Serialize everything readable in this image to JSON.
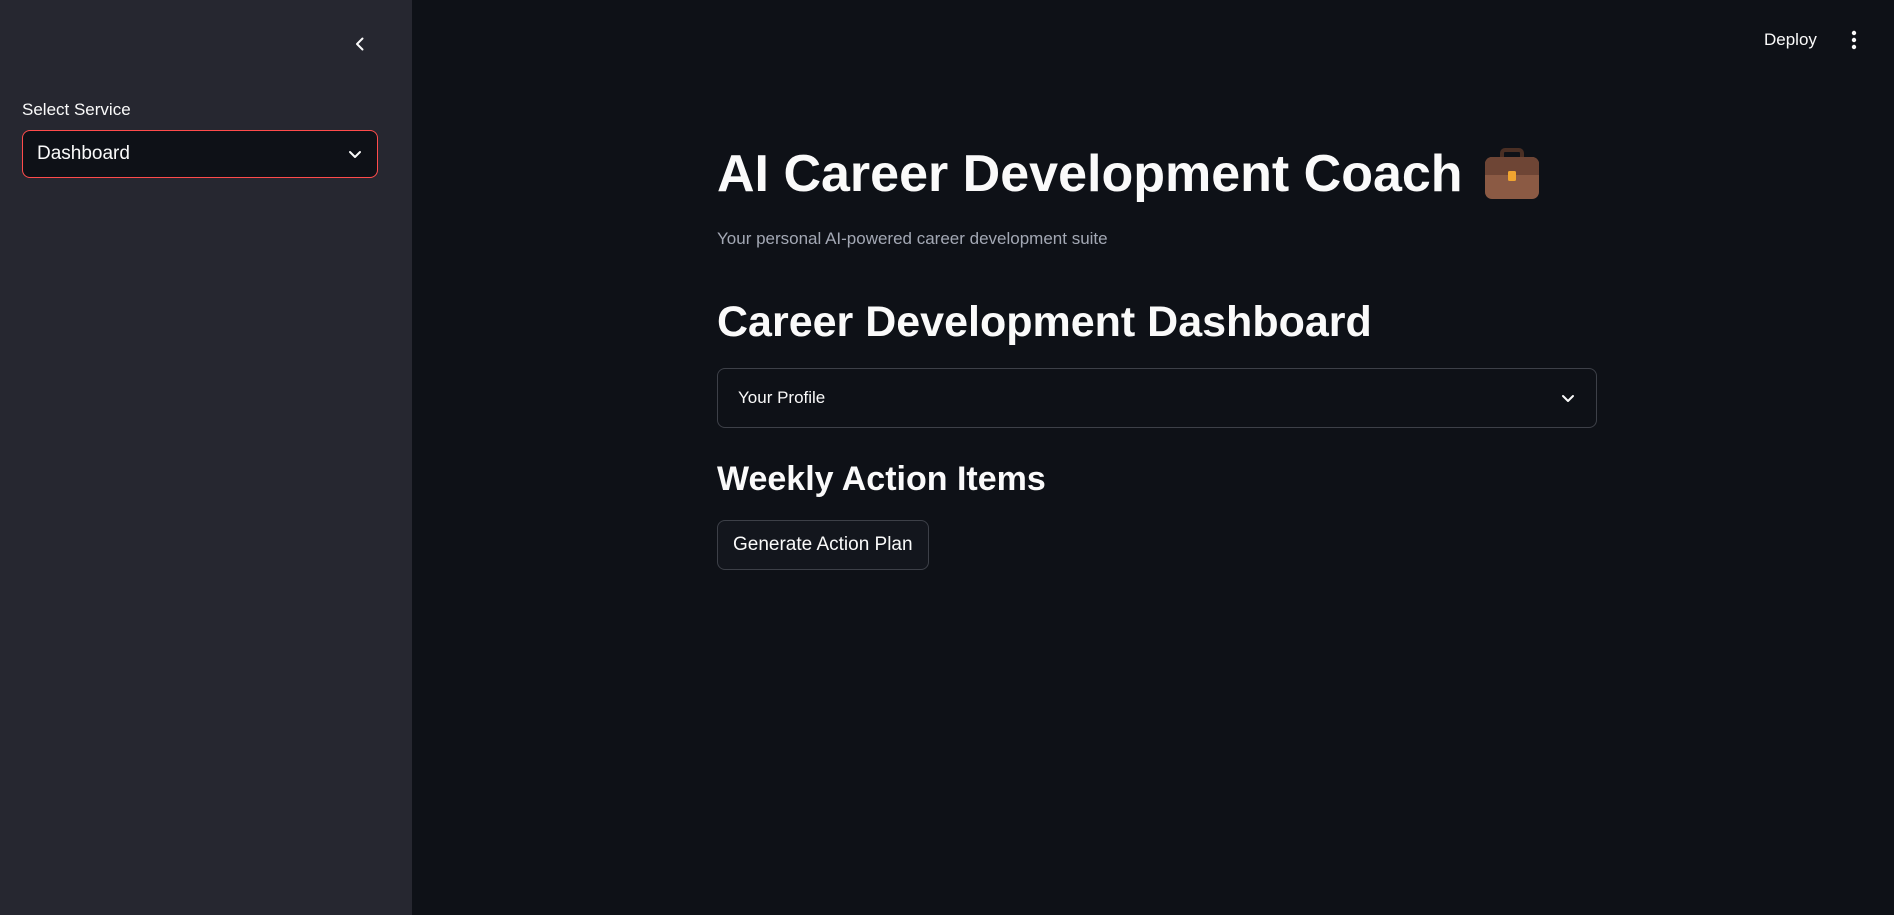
{
  "sidebar": {
    "collapse_icon": "chevron-left-icon",
    "select_label": "Select Service",
    "select_value": "Dashboard",
    "select_icon": "chevron-down-icon",
    "accent_color": "#ff4b4b"
  },
  "header": {
    "deploy_label": "Deploy",
    "menu_icon": "vertical-dots-icon"
  },
  "main": {
    "title": "AI Career Development Coach",
    "title_icon": "briefcase-icon",
    "subtitle": "Your personal AI-powered career development suite",
    "section_title": "Career Development Dashboard",
    "expander": {
      "label": "Your Profile",
      "icon": "chevron-down-icon"
    },
    "subsection_title": "Weekly Action Items",
    "action_button_label": "Generate Action Plan"
  },
  "colors": {
    "background": "#0e1117",
    "sidebar_background": "#262730",
    "text": "#fafafa",
    "muted_text": "#a3a8b4",
    "border": "#3d4048"
  }
}
